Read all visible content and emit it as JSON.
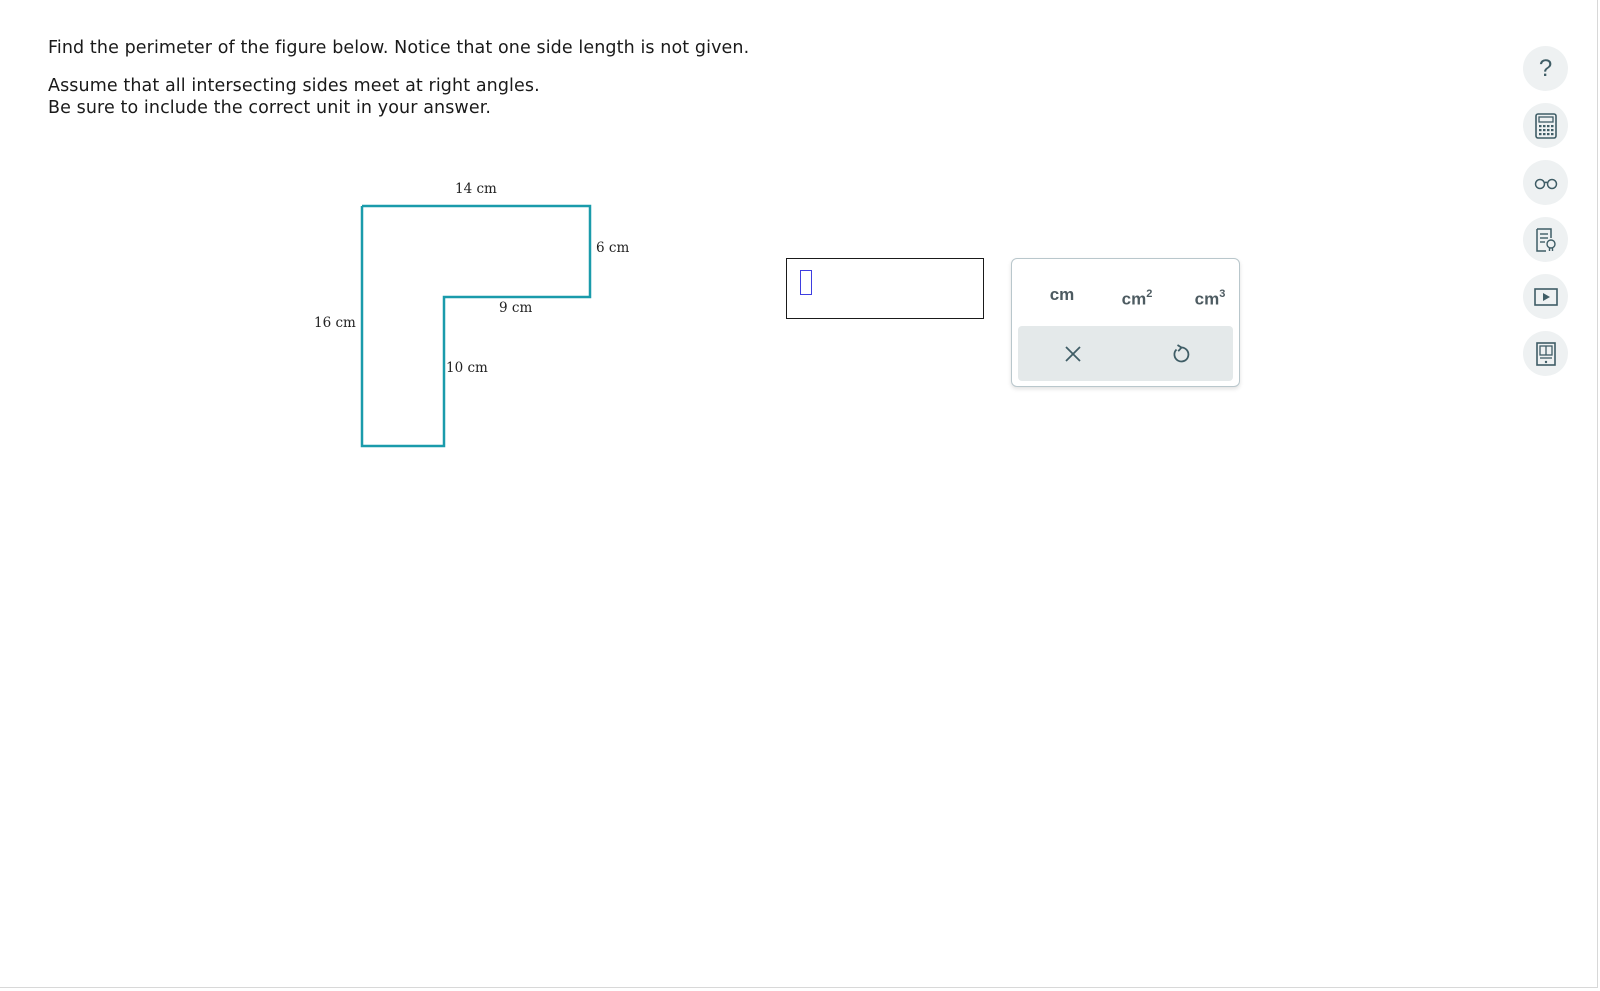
{
  "problem": {
    "line1": "Find the perimeter of the figure below. Notice that one side length is not given.",
    "line2": "Assume that all intersecting sides meet at right angles.",
    "line3": "Be sure to include the correct unit in your answer."
  },
  "figure": {
    "labels": {
      "top": "14 cm",
      "right": "6 cm",
      "inner_horizontal": "9 cm",
      "left": "16 cm",
      "inner_vertical": "10 cm"
    },
    "stroke_color": "#1a9bab"
  },
  "answer": {
    "value": ""
  },
  "units": {
    "cm": {
      "base": "cm",
      "exp": ""
    },
    "cm2": {
      "base": "cm",
      "exp": "2"
    },
    "cm3": {
      "base": "cm",
      "exp": "3"
    }
  },
  "actions": {
    "clear_icon": "close-icon",
    "undo_icon": "undo-icon"
  },
  "sidebar_tools": [
    "help-icon",
    "calculator-icon",
    "glasses-icon",
    "notes-icon",
    "video-icon",
    "textbook-icon"
  ],
  "colors": {
    "accent": "#1a9bab",
    "tool_icon": "#3f5d66",
    "tool_bg": "#eef1f2",
    "caret": "#3e3ee0",
    "action_bar": "#e4e9ea"
  }
}
